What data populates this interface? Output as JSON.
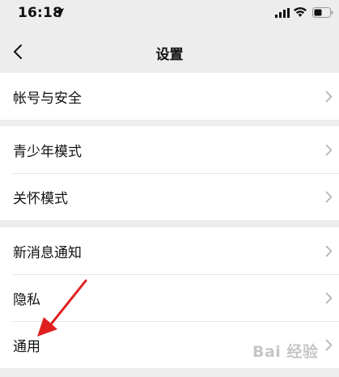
{
  "status_bar": {
    "time": "16:18"
  },
  "nav": {
    "title": "设置"
  },
  "groups": [
    {
      "items": [
        {
          "label": "帐号与安全"
        }
      ]
    },
    {
      "items": [
        {
          "label": "青少年模式"
        },
        {
          "label": "关怀模式"
        }
      ]
    },
    {
      "items": [
        {
          "label": "新消息通知"
        },
        {
          "label": "隐私"
        },
        {
          "label": "通用"
        }
      ]
    }
  ],
  "annotation": {
    "color": "#e02020",
    "points_to": "通用"
  },
  "watermark": {
    "text": "Bai 经验"
  },
  "colors": {
    "background": "#ededed",
    "row_background": "#ffffff",
    "chevron": "#b2b2b2"
  }
}
